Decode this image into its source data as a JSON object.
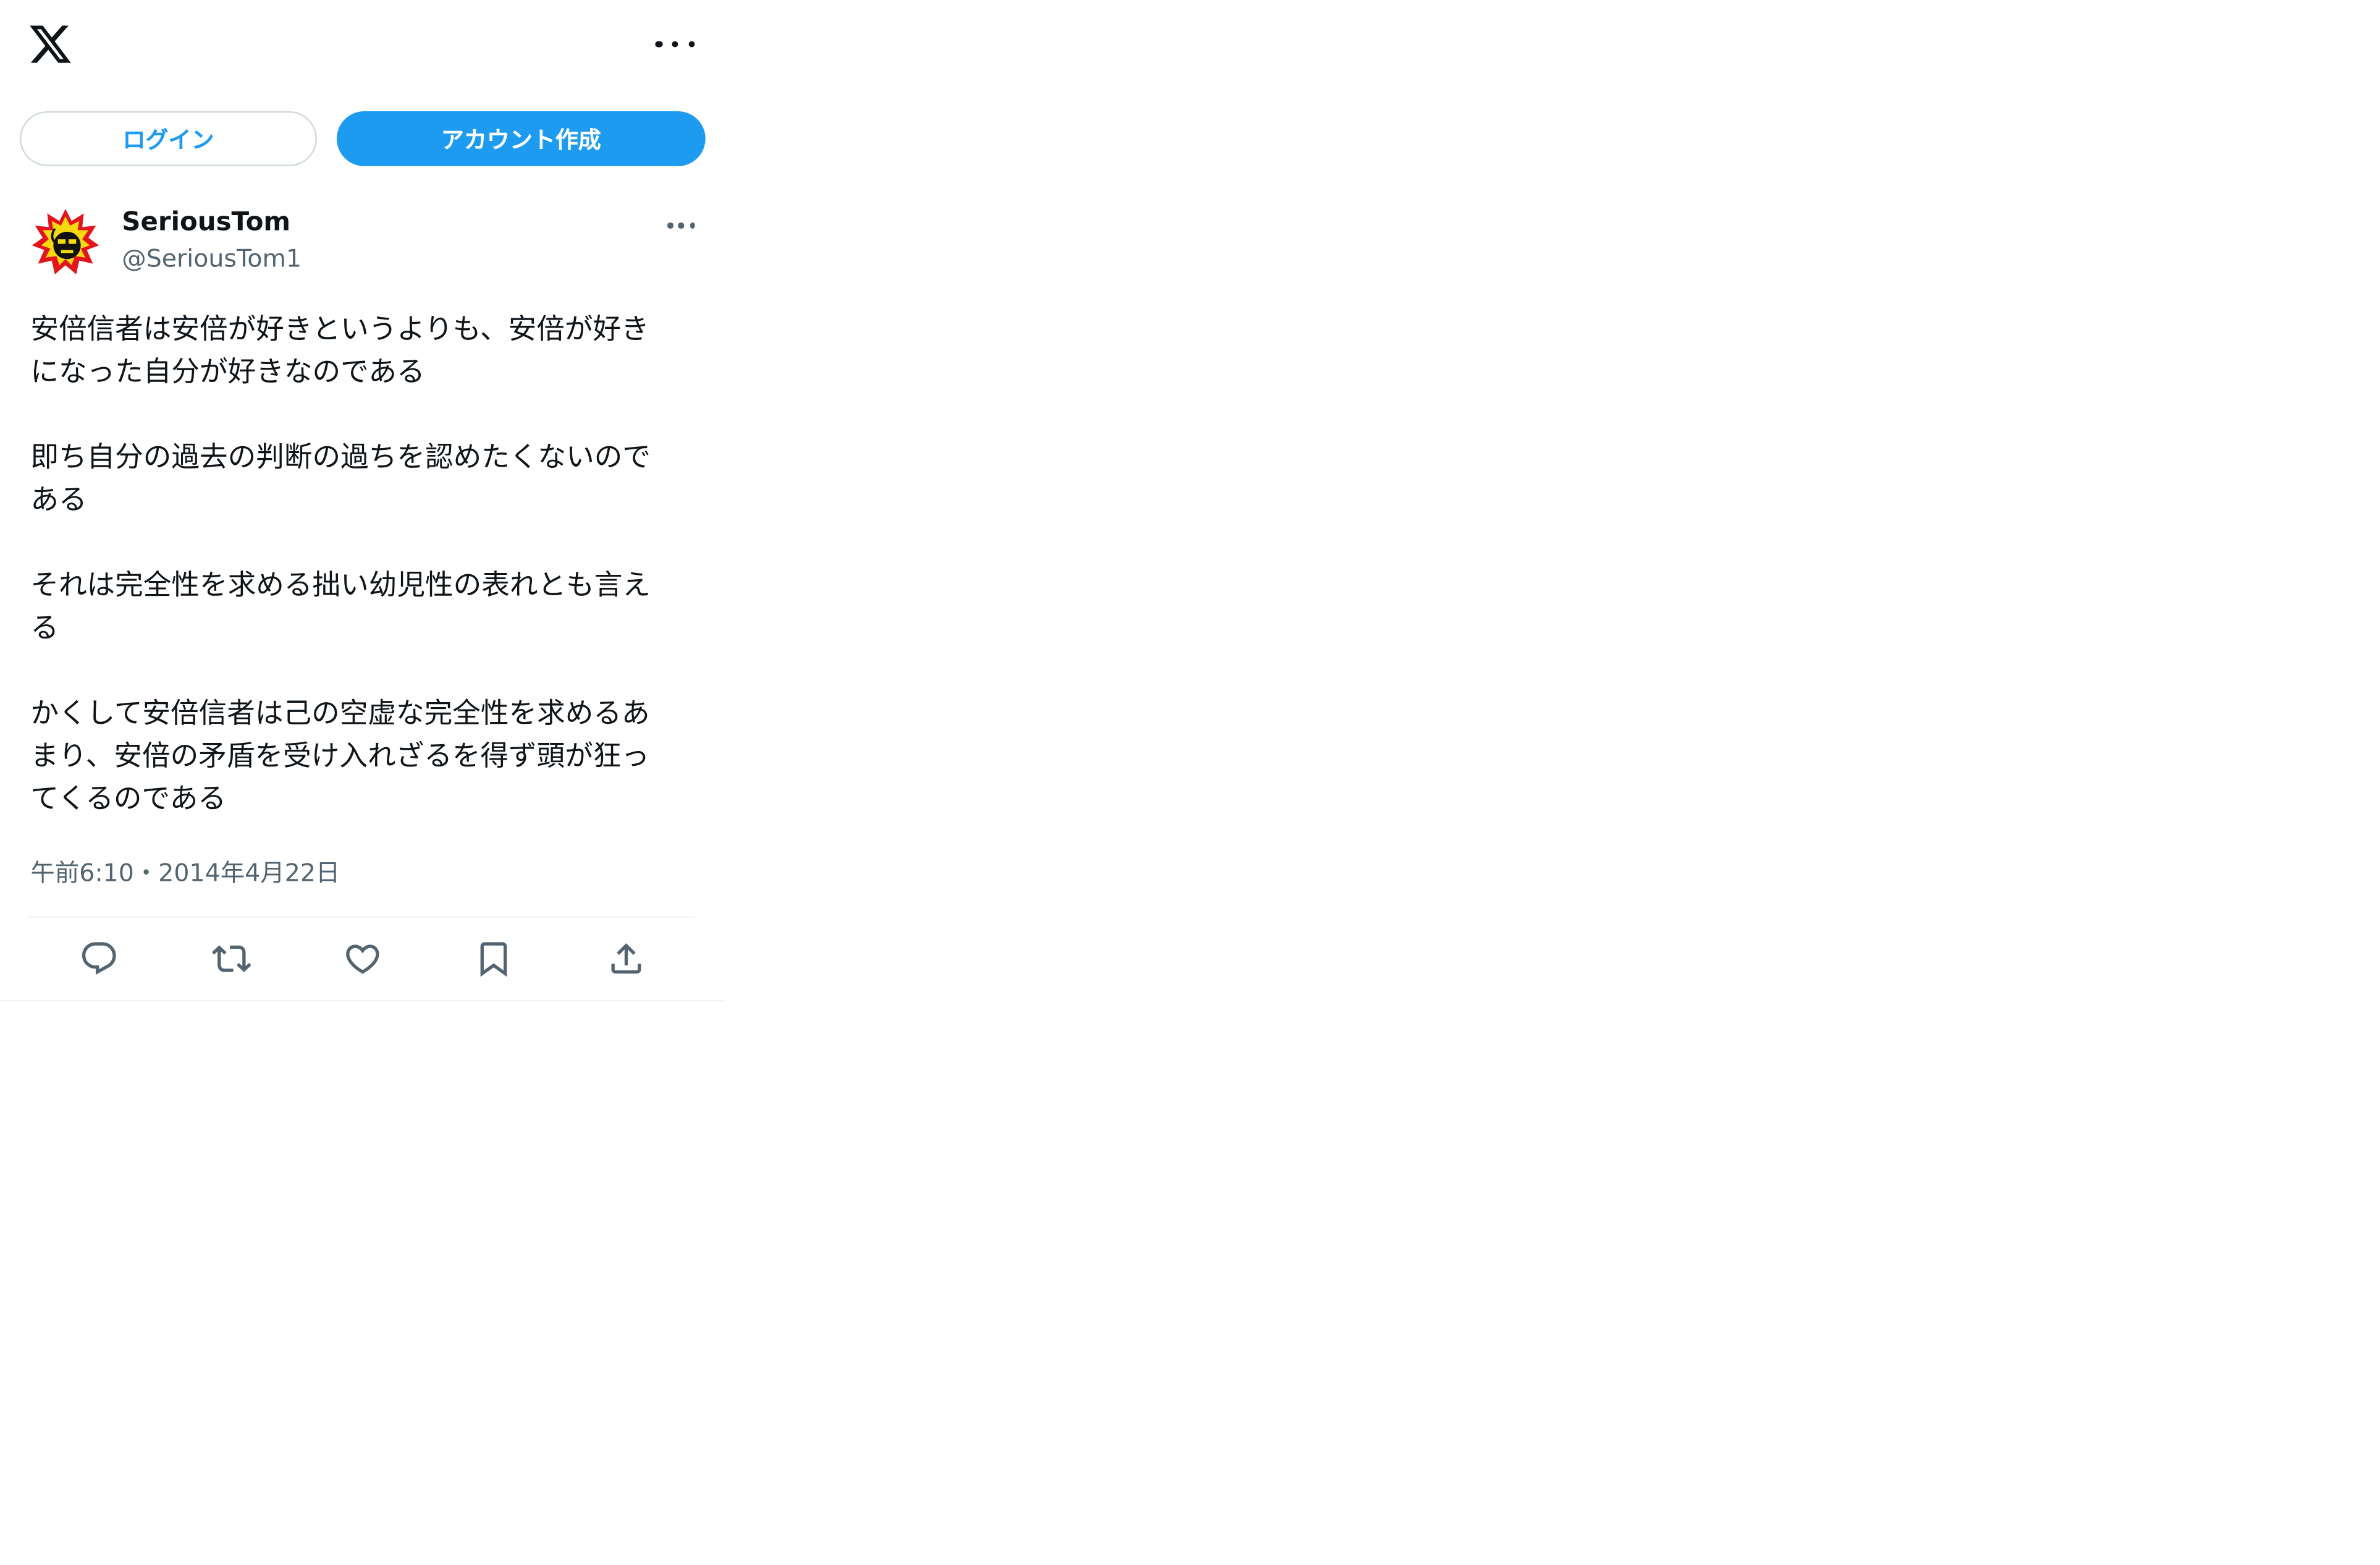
{
  "header": {
    "logo_icon": "x-logo-icon",
    "more_icon": "more-horizontal-icon"
  },
  "auth": {
    "login_label": "ログイン",
    "signup_label": "アカウント作成"
  },
  "author": {
    "name": "SeriousTom",
    "handle": "@SeriousTom1",
    "avatar_icon": "serious-sam-bomb-avatar"
  },
  "tweet": {
    "text": "安倍信者は安倍が好きというよりも、安倍が好き\nになった自分が好きなのである\n\n即ち自分の過去の判断の過ちを認めたくないので\nある\n\nそれは完全性を求める拙い幼児性の表れとも言え\nる\n\nかくして安倍信者は己の空虚な完全性を求めるあ\nまり、安倍の矛盾を受け入れざるを得ず頭が狂っ\nてくるのである",
    "timestamp": "午前6:10・2014年4月22日"
  },
  "actions": {
    "reply_icon": "reply-icon",
    "retweet_icon": "retweet-icon",
    "like_icon": "heart-icon",
    "bookmark_icon": "bookmark-icon",
    "share_icon": "share-icon"
  },
  "colors": {
    "accent": "#1d9bf0",
    "text": "#0f1419",
    "secondary": "#536471",
    "border": "#cfd9de"
  }
}
